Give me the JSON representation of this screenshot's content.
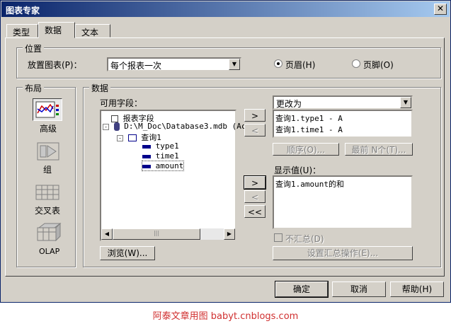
{
  "window": {
    "title": "图表专家",
    "close_glyph": "✕"
  },
  "tabs": [
    {
      "label": "类型"
    },
    {
      "label": "数据"
    },
    {
      "label": "文本"
    }
  ],
  "position": {
    "group_label": "位置",
    "place_label": "放置图表(P)：",
    "place_value": "每个报表一次",
    "header_label": "页眉(H)",
    "footer_label": "页脚(O)"
  },
  "layout": {
    "group_label": "布局",
    "items": [
      {
        "label": "高级"
      },
      {
        "label": "组"
      },
      {
        "label": "交叉表"
      },
      {
        "label": "OLAP"
      }
    ]
  },
  "data": {
    "group_label": "数据",
    "available_label": "可用字段：",
    "tree": [
      {
        "label": "报表字段"
      },
      {
        "label": "D:\\M_Doc\\Database3.mdb (Ac"
      },
      {
        "label": "查询1"
      },
      {
        "label": "type1"
      },
      {
        "label": "time1"
      },
      {
        "label": "amount"
      }
    ],
    "browse_button": "浏览(W)...",
    "change_label": "更改为",
    "change_items": [
      "查询1.type1 - A",
      "查询1.time1 - A"
    ],
    "order_button": "顺序(O)...",
    "topn_button": "最前 N个(T)...",
    "show_label": "显示值(U)：",
    "show_items": [
      "查询1.amount的和"
    ],
    "nosum_label": "不汇总(D)",
    "summary_button": "设置汇总操作(E)...",
    "arrow_right": ">",
    "arrow_left": "<",
    "arrow_all_left": "<<"
  },
  "footer_buttons": {
    "ok": "确定",
    "cancel": "取消",
    "help": "帮助(H)"
  },
  "caption": "阿泰文章用图  babyt.cnblogs.com"
}
